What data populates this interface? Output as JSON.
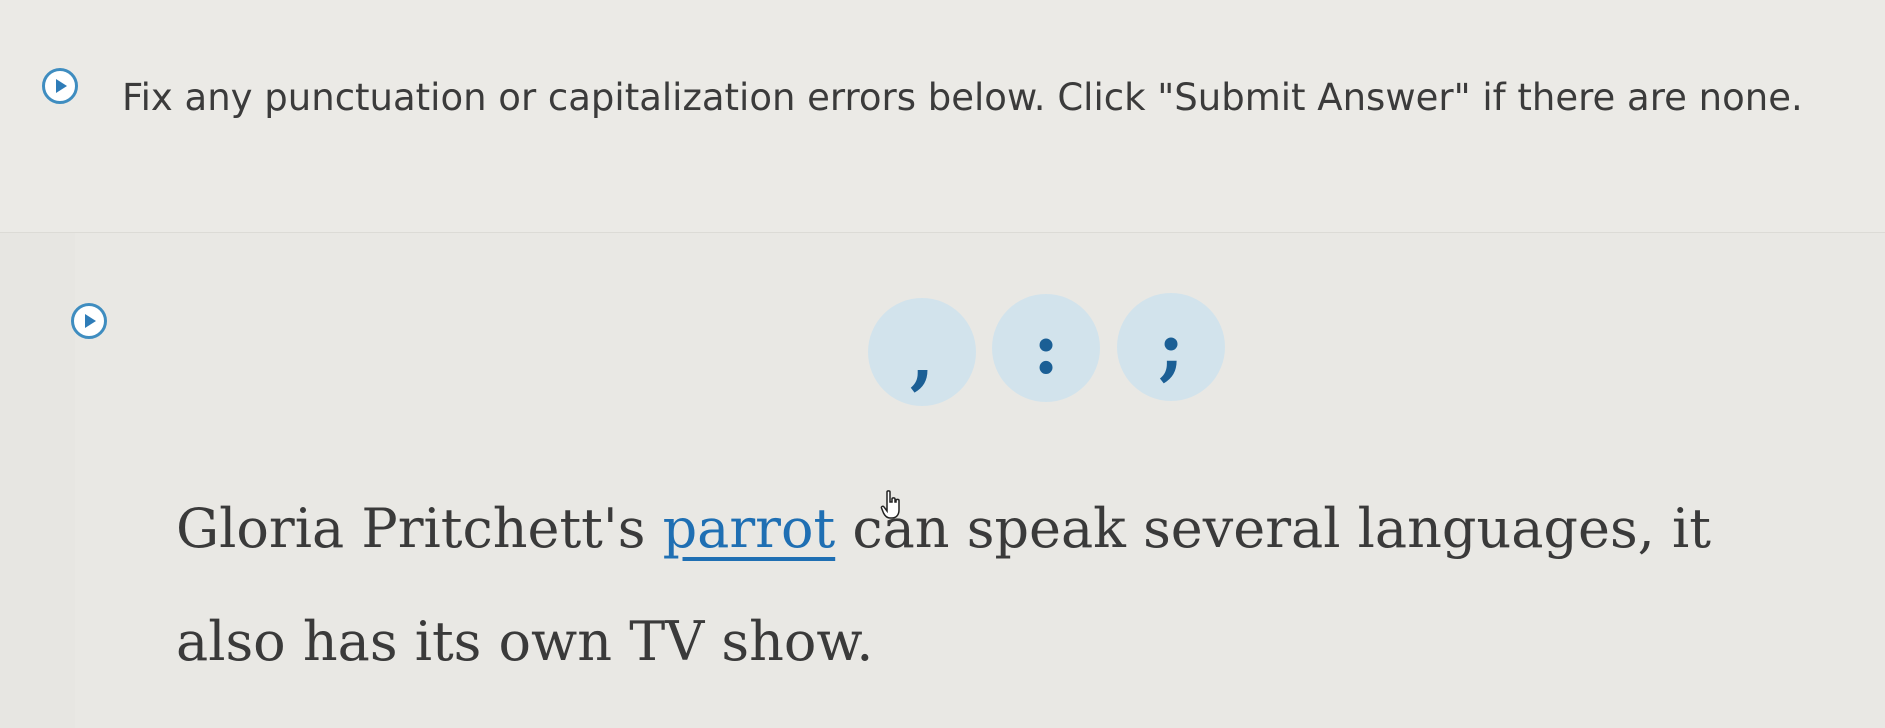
{
  "instructions": {
    "text": "Fix any punctuation or capitalization errors below. Click \"Submit Answer\" if there are none.",
    "audio_icon": "play-icon"
  },
  "question": {
    "audio_icon": "play-icon",
    "punctuation_buttons": {
      "comma": ",",
      "colon": ":",
      "semicolon": ";"
    },
    "sentence": {
      "before": "Gloria Pritchett's ",
      "selected_word": "parrot",
      "after": " can speak several languages, it also has its own TV show."
    }
  },
  "colors": {
    "accent": "#1f6fb3",
    "button_bg": "#d2e3ec",
    "text": "#3a3a3a",
    "background": "#e9e8e4"
  }
}
